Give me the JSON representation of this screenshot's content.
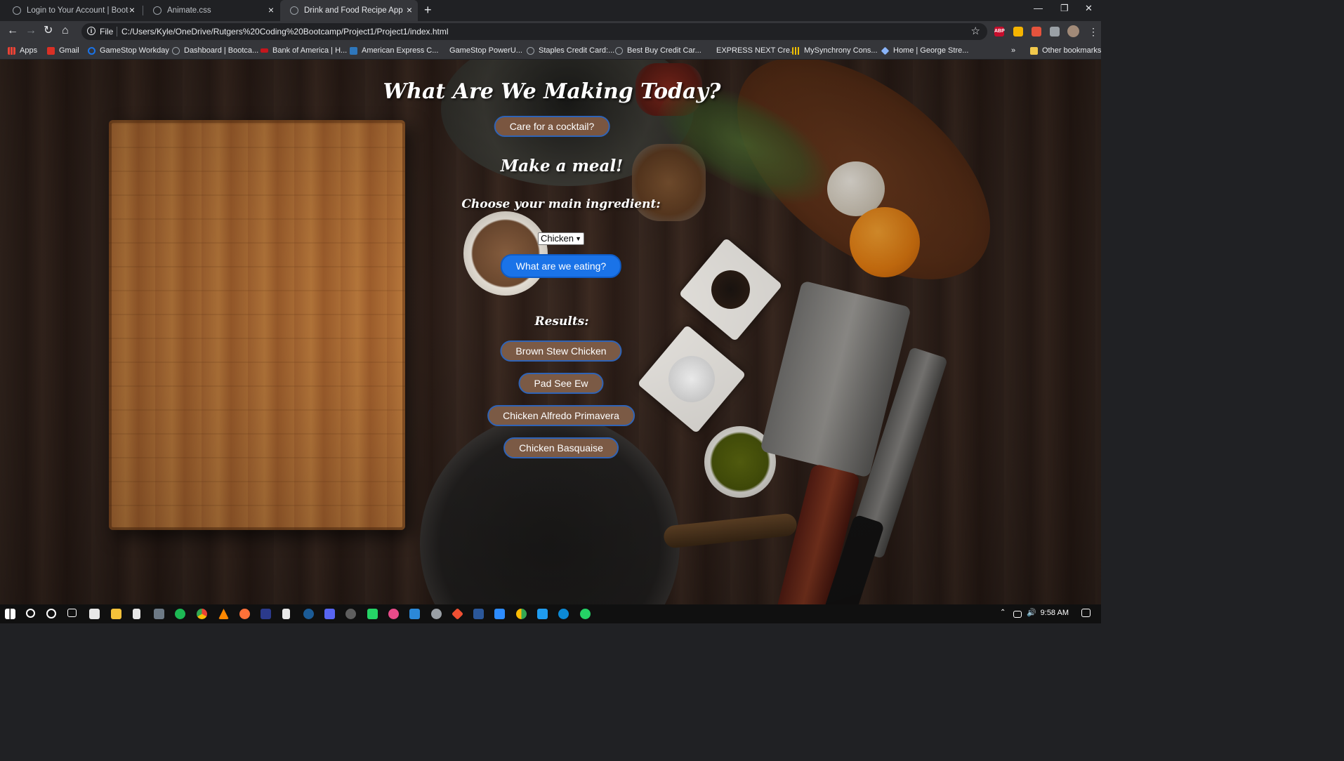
{
  "browser": {
    "tabs": [
      {
        "title": "Login to Your Account | Bootcam",
        "active": false
      },
      {
        "title": "Animate.css",
        "active": false
      },
      {
        "title": "Drink and Food Recipe App",
        "active": true
      }
    ],
    "address": {
      "scheme_label": "File",
      "url": "C:/Users/Kyle/OneDrive/Rutgers%20Coding%20Bootcamp/Project1/Project1/index.html"
    },
    "extensions": [
      {
        "name": "abp-icon",
        "label": "ABP",
        "color": "#c70d2c"
      },
      {
        "name": "honey-icon",
        "label": "",
        "color": "#f5b400"
      },
      {
        "name": "redirect-icon",
        "label": "",
        "color": "#e5533d"
      },
      {
        "name": "puzzle-icon",
        "label": "",
        "color": "#9aa0a6"
      }
    ],
    "bookmarks": [
      {
        "label": "Apps",
        "icon_color": "#ea4335"
      },
      {
        "label": "Gmail",
        "icon_color": "#d93025"
      },
      {
        "label": "GameStop Workday",
        "icon_color": "#1a73e8"
      },
      {
        "label": "Dashboard | Bootca...",
        "icon_color": "#9aa0a6"
      },
      {
        "label": "Bank of America | H...",
        "icon_color": "#c5161d"
      },
      {
        "label": "American Express C...",
        "icon_color": "#2e77bc"
      },
      {
        "label": "GameStop PowerU...",
        "icon_color": "#35363a"
      },
      {
        "label": "Staples Credit Card:...",
        "icon_color": "#9aa0a6"
      },
      {
        "label": "Best Buy Credit Car...",
        "icon_color": "#9aa0a6"
      },
      {
        "label": "EXPRESS NEXT Cre...",
        "icon_color": "#35363a"
      },
      {
        "label": "MySynchrony Cons...",
        "icon_color": "#f2c100"
      },
      {
        "label": "Home | George Stre...",
        "icon_color": "#8ab4f8"
      }
    ],
    "more_bookmarks": "»",
    "other_bookmarks": "Other bookmarks"
  },
  "app": {
    "title": "What Are We Making Today?",
    "cocktail_button": "Care for a cocktail?",
    "meal_heading": "Make a meal!",
    "ingredient_prompt": "Choose your main ingredient:",
    "ingredient_selected": "Chicken",
    "eat_button": "What are we eating?",
    "results_heading": "Results:",
    "results": [
      "Brown Stew Chicken",
      "Pad See Ew",
      "Chicken Alfredo Primavera",
      "Chicken Basquaise"
    ]
  },
  "taskbar": {
    "clock": "9:58 AM",
    "apps": [
      {
        "name": "file-explorer-icon",
        "color": "#f3c13a"
      },
      {
        "name": "notepad-icon",
        "color": "#e8e8e8"
      },
      {
        "name": "photos-icon",
        "color": "#6d7a86"
      },
      {
        "name": "spotify-icon",
        "color": "#1db954"
      },
      {
        "name": "chrome-icon",
        "color": "#4285f4"
      },
      {
        "name": "vlc-icon",
        "color": "#ff8800"
      },
      {
        "name": "firefox-icon",
        "color": "#ff7139"
      },
      {
        "name": "photoshop-icon",
        "color": "#2b3a8c"
      },
      {
        "name": "document-icon",
        "color": "#e8e8e8"
      },
      {
        "name": "steam-icon",
        "color": "#1b5b96"
      },
      {
        "name": "discord-icon",
        "color": "#5865f2"
      },
      {
        "name": "obs-icon",
        "color": "#5e5e5e"
      },
      {
        "name": "messenger-icon",
        "color": "#25d366"
      },
      {
        "name": "app-icon",
        "color": "#e94b8a"
      },
      {
        "name": "mail-icon",
        "color": "#2b88d8"
      },
      {
        "name": "cloud-icon",
        "color": "#9aa0a6"
      },
      {
        "name": "git-icon",
        "color": "#f05033"
      },
      {
        "name": "word-icon",
        "color": "#2b579a"
      },
      {
        "name": "zoom-icon",
        "color": "#2d8cff"
      },
      {
        "name": "chrome-alt-icon",
        "color": "#34a853"
      },
      {
        "name": "vscode-icon",
        "color": "#1f9cf0"
      },
      {
        "name": "edge-icon",
        "color": "#0c8ad6"
      },
      {
        "name": "whatsapp-icon",
        "color": "#25d366"
      }
    ]
  }
}
